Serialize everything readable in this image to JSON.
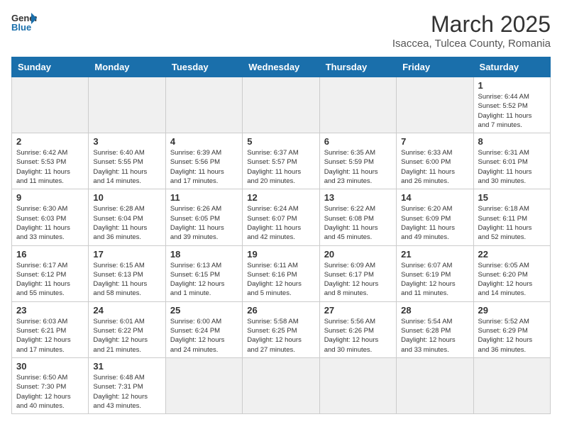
{
  "header": {
    "logo_general": "General",
    "logo_blue": "Blue",
    "month_title": "March 2025",
    "location": "Isaccea, Tulcea County, Romania"
  },
  "weekdays": [
    "Sunday",
    "Monday",
    "Tuesday",
    "Wednesday",
    "Thursday",
    "Friday",
    "Saturday"
  ],
  "weeks": [
    [
      {
        "day": "",
        "info": ""
      },
      {
        "day": "",
        "info": ""
      },
      {
        "day": "",
        "info": ""
      },
      {
        "day": "",
        "info": ""
      },
      {
        "day": "",
        "info": ""
      },
      {
        "day": "",
        "info": ""
      },
      {
        "day": "1",
        "info": "Sunrise: 6:44 AM\nSunset: 5:52 PM\nDaylight: 11 hours\nand 7 minutes."
      }
    ],
    [
      {
        "day": "2",
        "info": "Sunrise: 6:42 AM\nSunset: 5:53 PM\nDaylight: 11 hours\nand 11 minutes."
      },
      {
        "day": "3",
        "info": "Sunrise: 6:40 AM\nSunset: 5:55 PM\nDaylight: 11 hours\nand 14 minutes."
      },
      {
        "day": "4",
        "info": "Sunrise: 6:39 AM\nSunset: 5:56 PM\nDaylight: 11 hours\nand 17 minutes."
      },
      {
        "day": "5",
        "info": "Sunrise: 6:37 AM\nSunset: 5:57 PM\nDaylight: 11 hours\nand 20 minutes."
      },
      {
        "day": "6",
        "info": "Sunrise: 6:35 AM\nSunset: 5:59 PM\nDaylight: 11 hours\nand 23 minutes."
      },
      {
        "day": "7",
        "info": "Sunrise: 6:33 AM\nSunset: 6:00 PM\nDaylight: 11 hours\nand 26 minutes."
      },
      {
        "day": "8",
        "info": "Sunrise: 6:31 AM\nSunset: 6:01 PM\nDaylight: 11 hours\nand 30 minutes."
      }
    ],
    [
      {
        "day": "9",
        "info": "Sunrise: 6:30 AM\nSunset: 6:03 PM\nDaylight: 11 hours\nand 33 minutes."
      },
      {
        "day": "10",
        "info": "Sunrise: 6:28 AM\nSunset: 6:04 PM\nDaylight: 11 hours\nand 36 minutes."
      },
      {
        "day": "11",
        "info": "Sunrise: 6:26 AM\nSunset: 6:05 PM\nDaylight: 11 hours\nand 39 minutes."
      },
      {
        "day": "12",
        "info": "Sunrise: 6:24 AM\nSunset: 6:07 PM\nDaylight: 11 hours\nand 42 minutes."
      },
      {
        "day": "13",
        "info": "Sunrise: 6:22 AM\nSunset: 6:08 PM\nDaylight: 11 hours\nand 45 minutes."
      },
      {
        "day": "14",
        "info": "Sunrise: 6:20 AM\nSunset: 6:09 PM\nDaylight: 11 hours\nand 49 minutes."
      },
      {
        "day": "15",
        "info": "Sunrise: 6:18 AM\nSunset: 6:11 PM\nDaylight: 11 hours\nand 52 minutes."
      }
    ],
    [
      {
        "day": "16",
        "info": "Sunrise: 6:17 AM\nSunset: 6:12 PM\nDaylight: 11 hours\nand 55 minutes."
      },
      {
        "day": "17",
        "info": "Sunrise: 6:15 AM\nSunset: 6:13 PM\nDaylight: 11 hours\nand 58 minutes."
      },
      {
        "day": "18",
        "info": "Sunrise: 6:13 AM\nSunset: 6:15 PM\nDaylight: 12 hours\nand 1 minute."
      },
      {
        "day": "19",
        "info": "Sunrise: 6:11 AM\nSunset: 6:16 PM\nDaylight: 12 hours\nand 5 minutes."
      },
      {
        "day": "20",
        "info": "Sunrise: 6:09 AM\nSunset: 6:17 PM\nDaylight: 12 hours\nand 8 minutes."
      },
      {
        "day": "21",
        "info": "Sunrise: 6:07 AM\nSunset: 6:19 PM\nDaylight: 12 hours\nand 11 minutes."
      },
      {
        "day": "22",
        "info": "Sunrise: 6:05 AM\nSunset: 6:20 PM\nDaylight: 12 hours\nand 14 minutes."
      }
    ],
    [
      {
        "day": "23",
        "info": "Sunrise: 6:03 AM\nSunset: 6:21 PM\nDaylight: 12 hours\nand 17 minutes."
      },
      {
        "day": "24",
        "info": "Sunrise: 6:01 AM\nSunset: 6:22 PM\nDaylight: 12 hours\nand 21 minutes."
      },
      {
        "day": "25",
        "info": "Sunrise: 6:00 AM\nSunset: 6:24 PM\nDaylight: 12 hours\nand 24 minutes."
      },
      {
        "day": "26",
        "info": "Sunrise: 5:58 AM\nSunset: 6:25 PM\nDaylight: 12 hours\nand 27 minutes."
      },
      {
        "day": "27",
        "info": "Sunrise: 5:56 AM\nSunset: 6:26 PM\nDaylight: 12 hours\nand 30 minutes."
      },
      {
        "day": "28",
        "info": "Sunrise: 5:54 AM\nSunset: 6:28 PM\nDaylight: 12 hours\nand 33 minutes."
      },
      {
        "day": "29",
        "info": "Sunrise: 5:52 AM\nSunset: 6:29 PM\nDaylight: 12 hours\nand 36 minutes."
      }
    ],
    [
      {
        "day": "30",
        "info": "Sunrise: 6:50 AM\nSunset: 7:30 PM\nDaylight: 12 hours\nand 40 minutes."
      },
      {
        "day": "31",
        "info": "Sunrise: 6:48 AM\nSunset: 7:31 PM\nDaylight: 12 hours\nand 43 minutes."
      },
      {
        "day": "",
        "info": ""
      },
      {
        "day": "",
        "info": ""
      },
      {
        "day": "",
        "info": ""
      },
      {
        "day": "",
        "info": ""
      },
      {
        "day": "",
        "info": ""
      }
    ]
  ]
}
